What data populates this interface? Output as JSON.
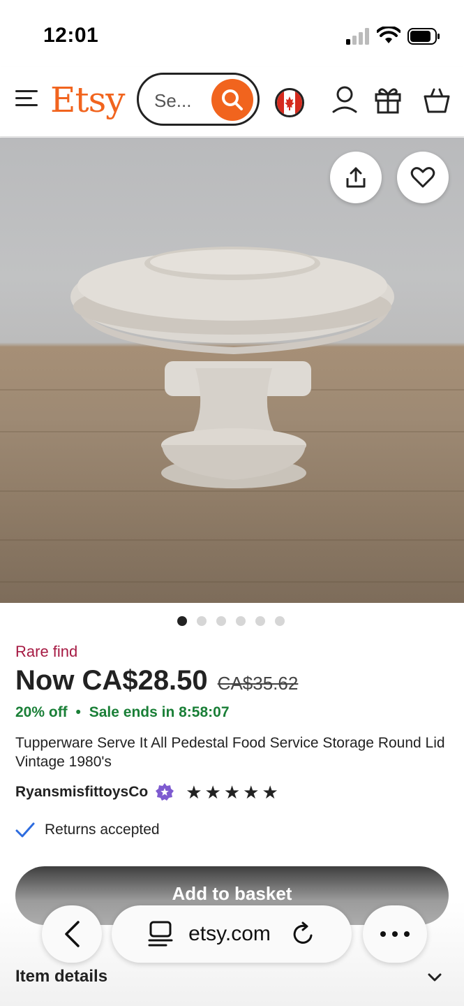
{
  "status": {
    "time": "12:01"
  },
  "header": {
    "logo": "Etsy",
    "search_placeholder": "Se...",
    "icons": [
      "menu-icon",
      "search-icon",
      "canada-flag-icon",
      "account-icon",
      "gift-icon",
      "basket-icon"
    ]
  },
  "gallery": {
    "image_count": 6,
    "active_index": 0,
    "icons": [
      "share-icon",
      "heart-icon"
    ]
  },
  "product": {
    "badge": "Rare find",
    "price_now": "Now CA$28.50",
    "price_original": "CA$35.62",
    "discount": "20% off",
    "sale_separator": "•",
    "sale_ends": "Sale ends in 8:58:07",
    "title": "Tupperware Serve It All Pedestal Food Service Storage Round Lid Vintage 1980's",
    "seller": "RyansmisfittoysCo",
    "rating_stars": 5,
    "returns": "Returns accepted",
    "add_to_basket": "Add to basket",
    "item_details": "Item details"
  },
  "browser": {
    "url": "etsy.com",
    "icons": [
      "back-icon",
      "tabs-icon",
      "reload-icon",
      "more-icon"
    ]
  },
  "colors": {
    "brand": "#f1641e",
    "rare_find": "#a61a43",
    "sale_green": "#1a7f37",
    "star_seller_badge": "#7e5bd0",
    "check_blue": "#2d6cdf"
  }
}
